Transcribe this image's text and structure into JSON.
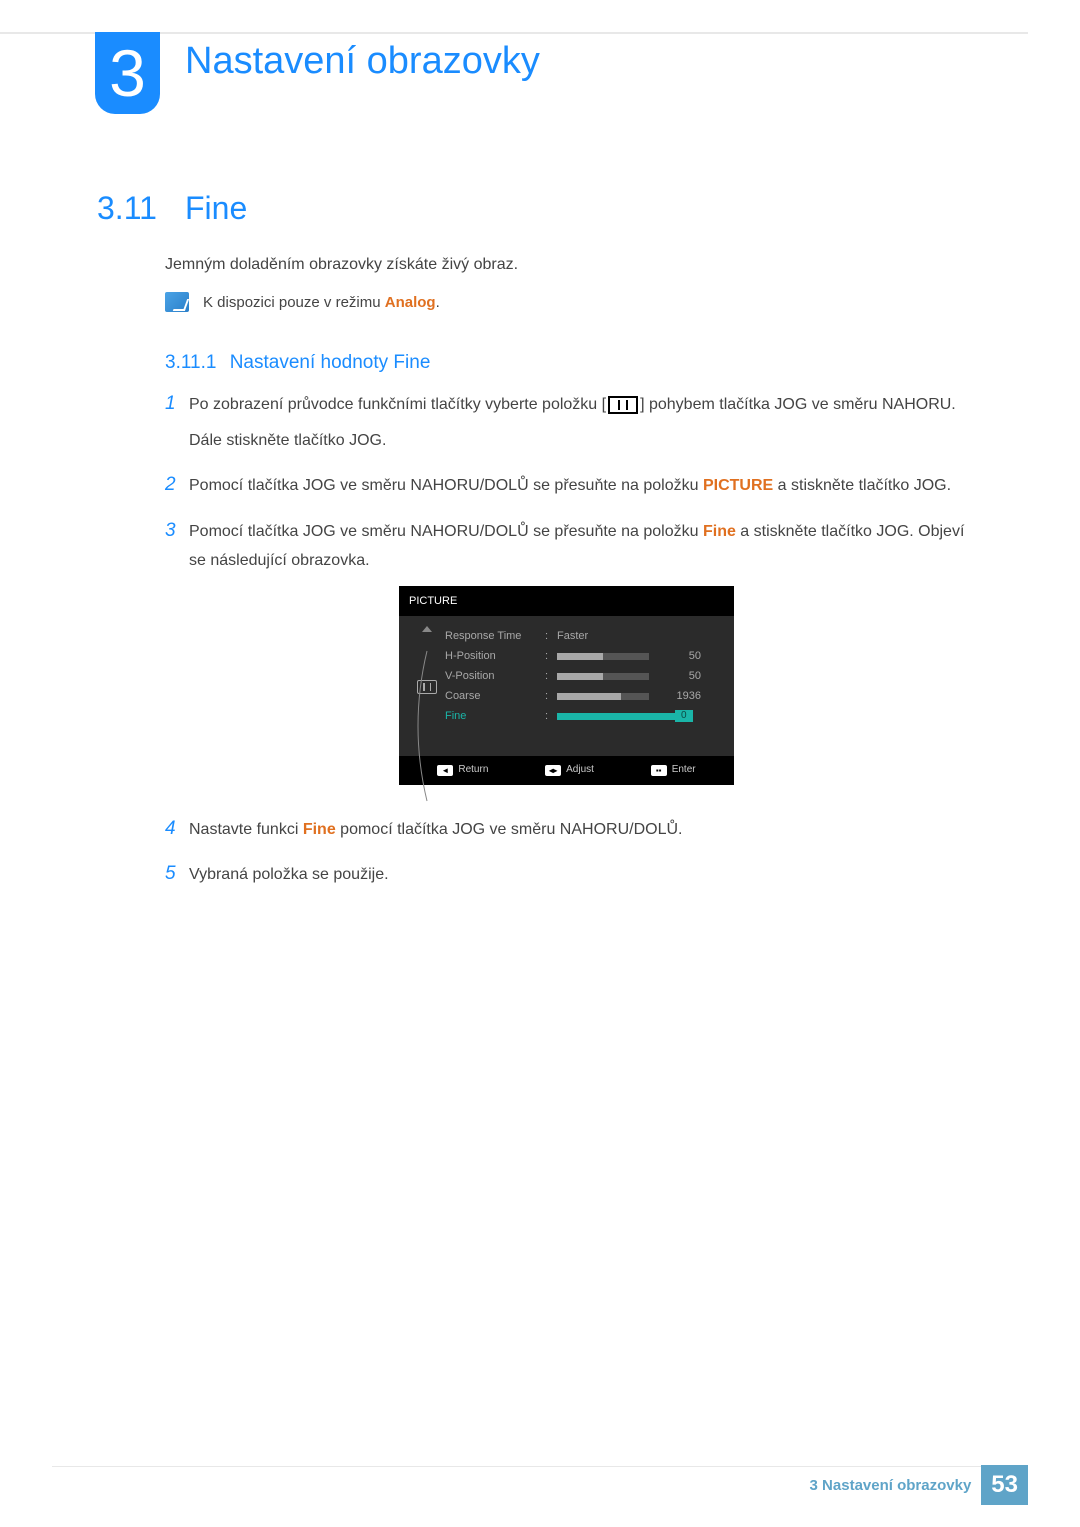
{
  "chapter": {
    "num": "3",
    "title": "Nastavení obrazovky"
  },
  "section": {
    "num": "3.11",
    "title": "Fine"
  },
  "intro": "Jemným doladěním obrazovky získáte živý obraz.",
  "note": {
    "prefix": "K dispozici pouze v režimu ",
    "highlight": "Analog",
    "suffix": "."
  },
  "subsection": {
    "num": "3.11.1",
    "title": "Nastavení hodnoty Fine"
  },
  "steps": {
    "1": {
      "pre": "Po zobrazení průvodce funkčními tlačítky vyberte položku [",
      "post": "] pohybem tlačítka JOG ve směru NAHORU.",
      "line2": "Dále stiskněte tlačítko JOG."
    },
    "2": {
      "pre": "Pomocí tlačítka JOG ve směru NAHORU/DOLŮ se přesuňte na položku ",
      "kw": "PICTURE",
      "post": " a stiskněte tlačítko JOG."
    },
    "3": {
      "pre": "Pomocí tlačítka JOG ve směru NAHORU/DOLŮ se přesuňte na položku ",
      "kw": "Fine",
      "post": " a stiskněte tlačítko JOG. Objeví se následující obrazovka."
    },
    "4": {
      "pre": "Nastavte funkci ",
      "kw": "Fine",
      "post": " pomocí tlačítka JOG ve směru NAHORU/DOLŮ."
    },
    "5": {
      "text": "Vybraná položka se použije."
    }
  },
  "osd": {
    "header": "PICTURE",
    "rows": {
      "response": {
        "label": "Response Time",
        "value": "Faster"
      },
      "hpos": {
        "label": "H-Position",
        "value": "50",
        "fill": 50
      },
      "vpos": {
        "label": "V-Position",
        "value": "50",
        "fill": 50
      },
      "coarse": {
        "label": "Coarse",
        "value": "1936",
        "fill": 70
      },
      "fine": {
        "label": "Fine",
        "value": "0",
        "fill": 100
      }
    },
    "footer": {
      "return": "Return",
      "adjust": "Adjust",
      "enter": "Enter"
    }
  },
  "footer": {
    "text": "3 Nastavení obrazovky",
    "page": "53"
  }
}
